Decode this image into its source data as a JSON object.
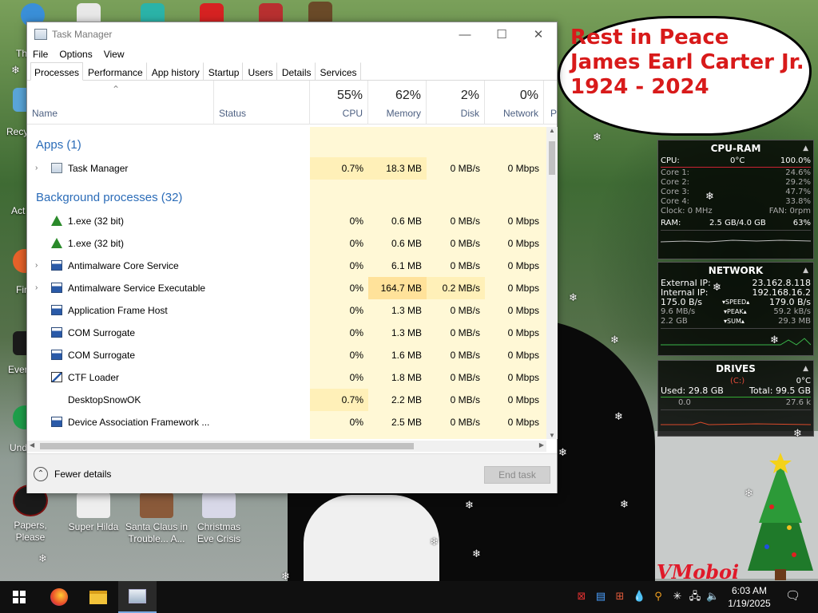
{
  "window": {
    "title": "Task Manager",
    "controls": {
      "minimize": "—",
      "maximize": "☐",
      "close": "✕"
    }
  },
  "menu": [
    "File",
    "Options",
    "View"
  ],
  "tabs": [
    "Processes",
    "Performance",
    "App history",
    "Startup",
    "Users",
    "Details",
    "Services"
  ],
  "columns": {
    "name": "Name",
    "status": "Status",
    "cpu": {
      "label": "CPU",
      "pct": "55%"
    },
    "memory": {
      "label": "Memory",
      "pct": "62%"
    },
    "disk": {
      "label": "Disk",
      "pct": "2%"
    },
    "network": {
      "label": "Network",
      "pct": "0%"
    },
    "power": "P"
  },
  "sections": {
    "apps": "Apps (1)",
    "background": "Background processes (32)"
  },
  "apps": [
    {
      "name": "Task Manager",
      "cpu": "0.7%",
      "memory": "18.3 MB",
      "disk": "0 MB/s",
      "network": "0 Mbps",
      "expand": true
    }
  ],
  "processes": [
    {
      "name": "1.exe (32 bit)",
      "cpu": "0%",
      "memory": "0.6 MB",
      "disk": "0 MB/s",
      "network": "0 Mbps",
      "expand": false
    },
    {
      "name": "1.exe (32 bit)",
      "cpu": "0%",
      "memory": "0.6 MB",
      "disk": "0 MB/s",
      "network": "0 Mbps",
      "expand": false
    },
    {
      "name": "Antimalware Core Service",
      "cpu": "0%",
      "memory": "6.1 MB",
      "disk": "0 MB/s",
      "network": "0 Mbps",
      "expand": true
    },
    {
      "name": "Antimalware Service Executable",
      "cpu": "0%",
      "memory": "164.7 MB",
      "disk": "0.2 MB/s",
      "network": "0 Mbps",
      "expand": true
    },
    {
      "name": "Application Frame Host",
      "cpu": "0%",
      "memory": "1.3 MB",
      "disk": "0 MB/s",
      "network": "0 Mbps",
      "expand": false
    },
    {
      "name": "COM Surrogate",
      "cpu": "0%",
      "memory": "1.3 MB",
      "disk": "0 MB/s",
      "network": "0 Mbps",
      "expand": false
    },
    {
      "name": "COM Surrogate",
      "cpu": "0%",
      "memory": "1.6 MB",
      "disk": "0 MB/s",
      "network": "0 Mbps",
      "expand": false
    },
    {
      "name": "CTF Loader",
      "cpu": "0%",
      "memory": "1.8 MB",
      "disk": "0 MB/s",
      "network": "0 Mbps",
      "expand": false
    },
    {
      "name": "DesktopSnowOK",
      "cpu": "0.7%",
      "memory": "2.2 MB",
      "disk": "0 MB/s",
      "network": "0 Mbps",
      "expand": false
    },
    {
      "name": "Device Association Framework ...",
      "cpu": "0%",
      "memory": "2.5 MB",
      "disk": "0 MB/s",
      "network": "0 Mbps",
      "expand": false
    }
  ],
  "footer": {
    "fewer_details": "Fewer details",
    "end_task": "End task"
  },
  "bubble": [
    "Rest in Peace",
    "James Earl Carter Jr.",
    "1924 - 2024"
  ],
  "desktop_icons": [
    {
      "label": "Papers, Please"
    },
    {
      "label": "Super Hilda"
    },
    {
      "label": "Santa Claus in Trouble... A..."
    },
    {
      "label": "Christmas Eve Crisis"
    }
  ],
  "edge_labels": [
    "Th",
    "Recy",
    "Act",
    "Fir",
    "Ever",
    "Und"
  ],
  "cpu_widget": {
    "title": "CPU-RAM",
    "cpu_label": "CPU:",
    "cpu_temp": "0°C",
    "cpu_total": "100.0%",
    "cores": [
      {
        "label": "Core 1:",
        "value": "24.6%"
      },
      {
        "label": "Core 2:",
        "value": "29.2%"
      },
      {
        "label": "Core 3:",
        "value": "47.7%"
      },
      {
        "label": "Core 4:",
        "value": "33.8%"
      }
    ],
    "clock": "Clock: 0 MHz",
    "fan": "FAN: 0rpm",
    "ram_label": "RAM:",
    "ram_value": "2.5 GB/4.0 GB",
    "ram_pct": "63%"
  },
  "network_widget": {
    "title": "NETWORK",
    "external_label": "External IP:",
    "external_ip": "23.162.8.118",
    "internal_label": "Internal IP:",
    "internal_ip": "192.168.16.2",
    "speed_down": "175.0 B/s",
    "speed_label": "SPEED",
    "speed_up": "179.0 B/s",
    "peak_down": "9.6 MB/s",
    "peak_label": "PEAK",
    "peak_up": "59.2 kB/s",
    "sum_down": "2.2 GB",
    "sum_label": "SUM",
    "sum_up": "29.3 MB"
  },
  "drives_widget": {
    "title": "DRIVES",
    "drive": "(C:)",
    "temp": "0°C",
    "used": "Used: 29.8 GB",
    "total": "Total: 99.5 GB",
    "read": "0.0",
    "write": "27.6 k"
  },
  "clock": {
    "time": "6:03 AM",
    "date": "1/19/2025"
  },
  "watermark": "VMoboi"
}
